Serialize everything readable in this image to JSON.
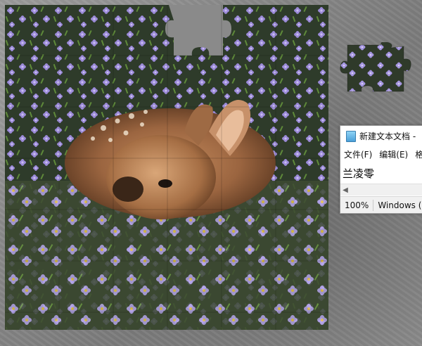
{
  "game": {
    "type": "jigsaw-puzzle",
    "image_subject": "fawn lying in purple phlox flowers",
    "board_background_color": "#8a8a8a",
    "missing_pieces": [
      "top-middle"
    ],
    "loose_pieces": 1
  },
  "notepad": {
    "title": "新建文本文档 -",
    "menu": [
      "文件(F)",
      "编辑(E)",
      "格"
    ],
    "content": "兰凌零",
    "status": {
      "zoom": "100%",
      "line_ending": "Windows (C"
    }
  }
}
